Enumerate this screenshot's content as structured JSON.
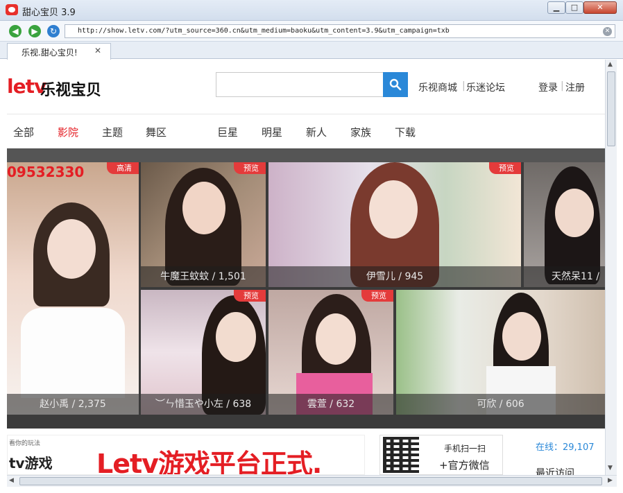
{
  "window": {
    "title": "甜心宝贝 3.9",
    "min": "▁",
    "max": "□",
    "close": "✕"
  },
  "nav": {
    "back": "◀",
    "forward": "▶",
    "refresh": "↻",
    "url": "http://show.letv.com/?utm_source=360.cn&utm_medium=baoku&utm_content=3.9&utm_campaign=txb",
    "clear": "✕"
  },
  "tab": {
    "label": "乐视.甜心宝贝!",
    "close": "✕"
  },
  "site": {
    "logo_mark": "letv",
    "logo_text": "乐视宝贝",
    "search_placeholder": "",
    "links": [
      "乐视商城",
      "乐迷论坛"
    ],
    "login": "登录",
    "register": "注册",
    "sep": "|"
  },
  "menu": [
    "全部",
    "影院",
    "主题",
    "舞区",
    "巨星",
    "明星",
    "新人",
    "家族",
    "下载"
  ],
  "menu_active": "影院",
  "cards": [
    {
      "caption": "赵小禹 / 2,375",
      "badge": "高清",
      "number": "09532330"
    },
    {
      "caption": "牛魔王蚊蚊 / 1,501",
      "badge": "预览"
    },
    {
      "caption": "伊雪儿 / 945",
      "badge": "预览"
    },
    {
      "caption": "天然呆11 /",
      "badge": ""
    },
    {
      "caption": "︶ㄣ惜玉や小左 / 638",
      "badge": "预览"
    },
    {
      "caption": "雲萱 / 632",
      "badge": "预览"
    },
    {
      "caption": "可欣 / 606",
      "badge": ""
    }
  ],
  "banner": {
    "small": "看你的玩法",
    "game": "tv游戏",
    "main": "Letv游戏平台正式."
  },
  "qr": {
    "line1": "手机扫一扫",
    "line2": "+官方微信"
  },
  "online": "在线：29,107",
  "recent": "最近访问",
  "scroll": {
    "up": "▲",
    "down": "▼",
    "left": "◀",
    "right": "▶"
  },
  "colors": {
    "brand": "#e41e24",
    "accent": "#2a88d8",
    "badge": "#e43b3b"
  }
}
